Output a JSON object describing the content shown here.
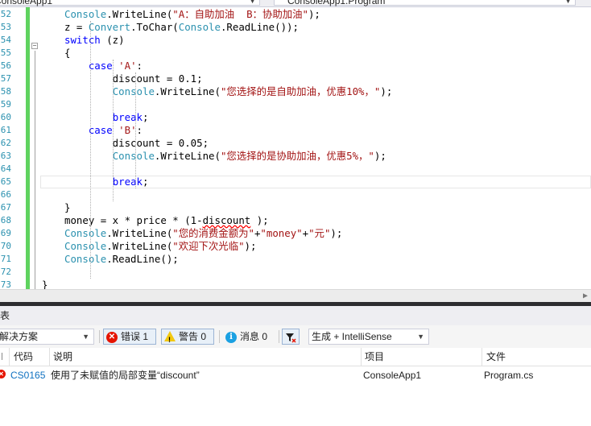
{
  "top_bar": {
    "project_combo": "ConsoleApp1",
    "member_combo": "ConsoleApp1.Program"
  },
  "editor": {
    "lines": [
      {
        "num": "52",
        "tokens": [
          {
            "t": "Console",
            "c": "ty"
          },
          {
            "t": ".WriteLine("
          },
          {
            "t": "\"A：自助加油  B：协助加油\"",
            "c": "st"
          },
          {
            "t": ");"
          }
        ]
      },
      {
        "num": "53",
        "tokens": [
          {
            "t": "z = "
          },
          {
            "t": "Convert",
            "c": "ty"
          },
          {
            "t": ".ToChar("
          },
          {
            "t": "Console",
            "c": "ty"
          },
          {
            "t": ".ReadLine());"
          }
        ]
      },
      {
        "num": "54",
        "tokens": [
          {
            "t": "switch",
            "c": "kw"
          },
          {
            "t": " (z)"
          }
        ]
      },
      {
        "num": "55",
        "tokens": [
          {
            "t": "{"
          }
        ]
      },
      {
        "num": "56",
        "tokens": [
          {
            "t": "    "
          },
          {
            "t": "case",
            "c": "kw"
          },
          {
            "t": " "
          },
          {
            "t": "'A'",
            "c": "st"
          },
          {
            "t": ":"
          }
        ]
      },
      {
        "num": "57",
        "tokens": [
          {
            "t": "        discount = 0.1;"
          }
        ]
      },
      {
        "num": "58",
        "tokens": [
          {
            "t": "        "
          },
          {
            "t": "Console",
            "c": "ty"
          },
          {
            "t": ".WriteLine("
          },
          {
            "t": "\"您选择的是自助加油，优惠10%，\"",
            "c": "st"
          },
          {
            "t": ");"
          }
        ]
      },
      {
        "num": "59",
        "tokens": [
          {
            "t": ""
          }
        ]
      },
      {
        "num": "60",
        "tokens": [
          {
            "t": "        "
          },
          {
            "t": "break",
            "c": "kw"
          },
          {
            "t": ";"
          }
        ]
      },
      {
        "num": "61",
        "tokens": [
          {
            "t": "    "
          },
          {
            "t": "case",
            "c": "kw"
          },
          {
            "t": " "
          },
          {
            "t": "'B'",
            "c": "st"
          },
          {
            "t": ":"
          }
        ]
      },
      {
        "num": "62",
        "tokens": [
          {
            "t": "        discount = 0.05;"
          }
        ]
      },
      {
        "num": "63",
        "tokens": [
          {
            "t": "        "
          },
          {
            "t": "Console",
            "c": "ty"
          },
          {
            "t": ".WriteLine("
          },
          {
            "t": "\"您选择的是协助加油，优惠5%，\"",
            "c": "st"
          },
          {
            "t": ");"
          }
        ]
      },
      {
        "num": "64",
        "tokens": [
          {
            "t": ""
          }
        ]
      },
      {
        "num": "65",
        "tokens": [
          {
            "t": "        "
          },
          {
            "t": "break",
            "c": "kw"
          },
          {
            "t": ";"
          }
        ]
      },
      {
        "num": "66",
        "tokens": [
          {
            "t": ""
          }
        ]
      },
      {
        "num": "67",
        "tokens": [
          {
            "t": "}"
          }
        ]
      },
      {
        "num": "68",
        "tokens": [
          {
            "t": "money = x * price * (1-"
          },
          {
            "t": "discount",
            "c": "sq"
          },
          {
            "t": " );"
          }
        ]
      },
      {
        "num": "69",
        "tokens": [
          {
            "t": "Console",
            "c": "ty"
          },
          {
            "t": ".WriteLine("
          },
          {
            "t": "\"您的消费金额为\"",
            "c": "st"
          },
          {
            "t": "+"
          },
          {
            "t": "\"money\"",
            "c": "st"
          },
          {
            "t": "+"
          },
          {
            "t": "\"元\"",
            "c": "st"
          },
          {
            "t": ");"
          }
        ]
      },
      {
        "num": "70",
        "tokens": [
          {
            "t": "Console",
            "c": "ty"
          },
          {
            "t": ".WriteLine("
          },
          {
            "t": "\"欢迎下次光临\"",
            "c": "st"
          },
          {
            "t": ");"
          }
        ]
      },
      {
        "num": "71",
        "tokens": [
          {
            "t": "Console",
            "c": "ty"
          },
          {
            "t": ".ReadLine();"
          }
        ]
      },
      {
        "num": "72",
        "tokens": [
          {
            "t": ""
          }
        ]
      },
      {
        "num": "73",
        "tokens": [
          {
            "t": "}"
          }
        ]
      }
    ]
  },
  "error_list": {
    "title": "表",
    "scope_select": "解决方案",
    "errors_label": "错误 1",
    "warnings_label": "警告 0",
    "messages_label": "消息 0",
    "build_select": "生成 + IntelliSense",
    "columns": {
      "code": "代码",
      "description": "说明",
      "project": "项目",
      "file": "文件"
    },
    "rows": [
      {
        "code": "CS0165",
        "description": "使用了未赋值的局部变量“discount”",
        "project": "ConsoleApp1",
        "file": "Program.cs"
      }
    ]
  }
}
